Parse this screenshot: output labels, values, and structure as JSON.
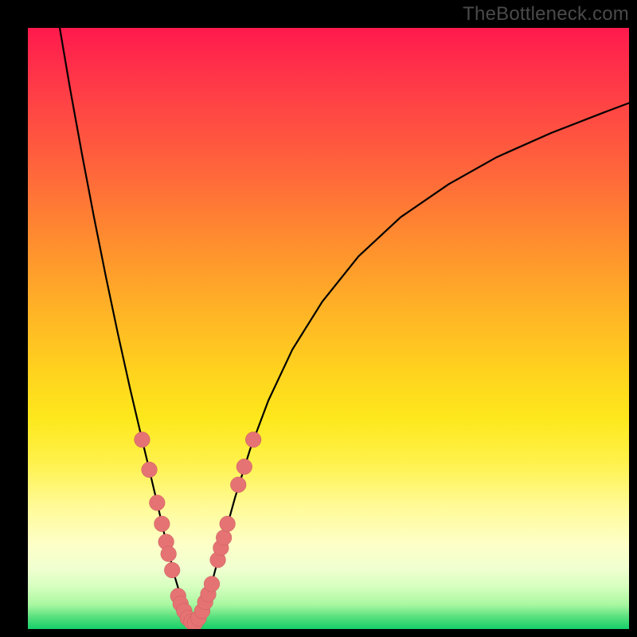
{
  "watermark": "TheBottleneck.com",
  "colors": {
    "curve": "#000000",
    "markers_fill": "#e57373",
    "markers_stroke": "#c95b5b",
    "frame": "#000000"
  },
  "chart_data": {
    "type": "line",
    "title": "",
    "xlabel": "",
    "ylabel": "",
    "xlim": [
      0,
      100
    ],
    "ylim": [
      0,
      100
    ],
    "grid": false,
    "legend": false,
    "note": "No numeric axis ticks or labels are rendered; values are normalized 0–100 from pixel estimates.",
    "series": [
      {
        "name": "bottleneck-curve",
        "x": [
          5.3,
          7.0,
          9.0,
          11.0,
          13.0,
          15.0,
          17.0,
          19.0,
          20.2,
          21.5,
          23.0,
          24.5,
          26.0,
          27.5,
          29.0,
          30.3,
          32.0,
          34.5,
          37.0,
          40.0,
          44.0,
          49.0,
          55.0,
          62.0,
          70.0,
          78.0,
          87.0,
          96.0,
          100.0
        ],
        "y": [
          100.0,
          90.0,
          79.0,
          68.5,
          58.5,
          49.0,
          40.0,
          31.5,
          26.5,
          21.0,
          14.5,
          8.5,
          3.5,
          1.0,
          2.5,
          6.5,
          13.0,
          22.0,
          30.0,
          38.0,
          46.5,
          54.5,
          62.0,
          68.5,
          74.0,
          78.5,
          82.5,
          86.0,
          87.5
        ]
      }
    ],
    "markers": [
      {
        "x": 19.0,
        "y": 31.5,
        "r": 1.3
      },
      {
        "x": 20.2,
        "y": 26.5,
        "r": 1.3
      },
      {
        "x": 21.5,
        "y": 21.0,
        "r": 1.3
      },
      {
        "x": 22.3,
        "y": 17.5,
        "r": 1.3
      },
      {
        "x": 23.0,
        "y": 14.5,
        "r": 1.3
      },
      {
        "x": 23.4,
        "y": 12.5,
        "r": 1.3
      },
      {
        "x": 24.0,
        "y": 9.8,
        "r": 1.3
      },
      {
        "x": 25.0,
        "y": 5.5,
        "r": 1.3
      },
      {
        "x": 25.4,
        "y": 4.2,
        "r": 1.3
      },
      {
        "x": 26.0,
        "y": 3.0,
        "r": 1.3
      },
      {
        "x": 26.6,
        "y": 1.8,
        "r": 1.3
      },
      {
        "x": 27.2,
        "y": 1.2,
        "r": 1.3
      },
      {
        "x": 27.8,
        "y": 1.0,
        "r": 1.3
      },
      {
        "x": 28.4,
        "y": 1.8,
        "r": 1.3
      },
      {
        "x": 29.0,
        "y": 3.0,
        "r": 1.3
      },
      {
        "x": 29.5,
        "y": 4.5,
        "r": 1.3
      },
      {
        "x": 30.0,
        "y": 5.8,
        "r": 1.3
      },
      {
        "x": 30.6,
        "y": 7.5,
        "r": 1.3
      },
      {
        "x": 31.6,
        "y": 11.5,
        "r": 1.3
      },
      {
        "x": 32.1,
        "y": 13.5,
        "r": 1.3
      },
      {
        "x": 32.6,
        "y": 15.2,
        "r": 1.3
      },
      {
        "x": 33.2,
        "y": 17.5,
        "r": 1.3
      },
      {
        "x": 35.0,
        "y": 24.0,
        "r": 1.3
      },
      {
        "x": 36.0,
        "y": 27.0,
        "r": 1.3
      },
      {
        "x": 37.5,
        "y": 31.5,
        "r": 1.3
      }
    ]
  }
}
